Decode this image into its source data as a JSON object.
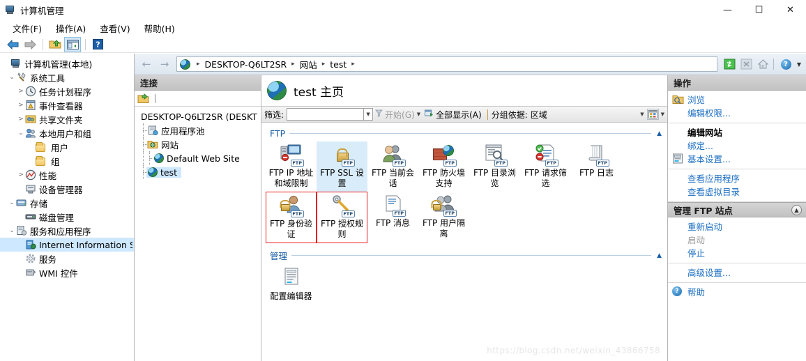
{
  "window": {
    "title": "计算机管理",
    "icon": "computer-management-icon",
    "minimize": "—",
    "maximize": "☐",
    "close": "✕"
  },
  "menubar": [
    {
      "label": "文件(F)",
      "name": "menu-file"
    },
    {
      "label": "操作(A)",
      "name": "menu-action"
    },
    {
      "label": "查看(V)",
      "name": "menu-view"
    },
    {
      "label": "帮助(H)",
      "name": "menu-help"
    }
  ],
  "toolbar": [
    {
      "name": "back-arrow-icon",
      "title": "后退"
    },
    {
      "name": "forward-arrow-icon",
      "title": "前进"
    },
    {
      "name": "up-folder-icon",
      "title": "向上"
    },
    {
      "name": "show-console-tree-icon",
      "title": "显示/隐藏控制台树"
    },
    {
      "name": "help-icon",
      "title": "帮助"
    }
  ],
  "tree": {
    "items": [
      {
        "label": "计算机管理(本地)",
        "indent": 0,
        "twisty": "",
        "icon": "computer-icon",
        "selected": false
      },
      {
        "label": "系统工具",
        "indent": 1,
        "twisty": "v",
        "icon": "tools-icon",
        "selected": false
      },
      {
        "label": "任务计划程序",
        "indent": 2,
        "twisty": ">",
        "icon": "clock-icon",
        "selected": false
      },
      {
        "label": "事件查看器",
        "indent": 2,
        "twisty": ">",
        "icon": "event-viewer-icon",
        "selected": false
      },
      {
        "label": "共享文件夹",
        "indent": 2,
        "twisty": ">",
        "icon": "shared-folder-icon",
        "selected": false
      },
      {
        "label": "本地用户和组",
        "indent": 2,
        "twisty": "v",
        "icon": "users-groups-icon",
        "selected": false
      },
      {
        "label": "用户",
        "indent": 3,
        "twisty": "",
        "icon": "folder-icon",
        "selected": false
      },
      {
        "label": "组",
        "indent": 3,
        "twisty": "",
        "icon": "folder-icon",
        "selected": false
      },
      {
        "label": "性能",
        "indent": 2,
        "twisty": ">",
        "icon": "performance-icon",
        "selected": false
      },
      {
        "label": "设备管理器",
        "indent": 2,
        "twisty": "",
        "icon": "device-manager-icon",
        "selected": false
      },
      {
        "label": "存储",
        "indent": 1,
        "twisty": "v",
        "icon": "storage-icon",
        "selected": false
      },
      {
        "label": "磁盘管理",
        "indent": 2,
        "twisty": "",
        "icon": "disk-icon",
        "selected": false
      },
      {
        "label": "服务和应用程序",
        "indent": 1,
        "twisty": "v",
        "icon": "services-apps-icon",
        "selected": false
      },
      {
        "label": "Internet Information S",
        "indent": 2,
        "twisty": "",
        "icon": "iis-icon",
        "selected": true
      },
      {
        "label": "服务",
        "indent": 2,
        "twisty": "",
        "icon": "service-gear-icon",
        "selected": false
      },
      {
        "label": "WMI 控件",
        "indent": 2,
        "twisty": "",
        "icon": "wmi-icon",
        "selected": false
      }
    ]
  },
  "address": {
    "back": "←",
    "forward": "→",
    "site_icon": "globe-icon",
    "crumbs": [
      "DESKTOP-Q6LT2SR",
      "网站",
      "test"
    ],
    "separator": "▸",
    "buttons": [
      {
        "name": "refresh-icon",
        "glyph": "refresh"
      },
      {
        "name": "stop-icon",
        "glyph": "stop"
      },
      {
        "name": "home-icon",
        "glyph": "home"
      },
      {
        "name": "help-icon",
        "glyph": "help"
      },
      {
        "name": "chevron-down-icon",
        "glyph": "caret"
      }
    ]
  },
  "connections": {
    "header": "连接",
    "toolbar_icon": "connect-folder-icon",
    "root": "DESKTOP-Q6LT2SR (DESKT",
    "items": [
      {
        "label": "应用程序池",
        "icon": "app-pools-icon",
        "indent": 0,
        "selected": false
      },
      {
        "label": "网站",
        "icon": "sites-folder-icon",
        "indent": 0,
        "selected": false
      },
      {
        "label": "Default Web Site",
        "icon": "globe-icon",
        "indent": 1,
        "selected": false
      },
      {
        "label": "test",
        "icon": "globe-icon",
        "indent": 1,
        "selected": true
      }
    ]
  },
  "content": {
    "page_title": "test 主页",
    "page_icon": "globe-icon",
    "filter": {
      "label": "筛选:",
      "value": "",
      "placeholder": "",
      "go_label": "开始(G)",
      "go_icon": "funnel-icon",
      "showall_label": "全部显示(A)",
      "showall_icon": "show-all-icon",
      "groupby_label": "分组依据:",
      "groupby_value": "区域",
      "view_icon": "view-mode-icon"
    },
    "groups": [
      {
        "name": "FTP",
        "chevron": "⌃",
        "items": [
          {
            "label": "FTP IP 地址和域限制",
            "icon": "ftp-ip-restrict-icon",
            "selected": false,
            "marked": false
          },
          {
            "label": "FTP SSL 设置",
            "icon": "ftp-ssl-icon",
            "selected": true,
            "marked": false
          },
          {
            "label": "FTP 当前会话",
            "icon": "ftp-sessions-icon",
            "selected": false,
            "marked": false
          },
          {
            "label": "FTP 防火墙支持",
            "icon": "ftp-firewall-icon",
            "selected": false,
            "marked": false
          },
          {
            "label": "FTP 目录浏览",
            "icon": "ftp-dir-browse-icon",
            "selected": false,
            "marked": false
          },
          {
            "label": "FTP 请求筛选",
            "icon": "ftp-request-filter-icon",
            "selected": false,
            "marked": false
          },
          {
            "label": "FTP 日志",
            "icon": "ftp-log-icon",
            "selected": false,
            "marked": false
          },
          {
            "label": "FTP 身份验证",
            "icon": "ftp-auth-icon",
            "selected": false,
            "marked": true
          },
          {
            "label": "FTP 授权规则",
            "icon": "ftp-authz-icon",
            "selected": false,
            "marked": true
          },
          {
            "label": "FTP 消息",
            "icon": "ftp-messages-icon",
            "selected": false,
            "marked": false
          },
          {
            "label": "FTP 用户隔离",
            "icon": "ftp-user-isolation-icon",
            "selected": false,
            "marked": false
          }
        ]
      },
      {
        "name": "管理",
        "chevron": "⌃",
        "items": [
          {
            "label": "配置编辑器",
            "icon": "config-editor-icon",
            "selected": false,
            "marked": false
          }
        ]
      }
    ]
  },
  "actions": {
    "header": "操作",
    "sections": [
      {
        "rows": [
          {
            "label": "浏览",
            "icon": "browse-icon",
            "style": "link",
            "name": "action-browse"
          },
          {
            "label": "编辑权限...",
            "icon": "",
            "style": "link",
            "name": "action-edit-permissions"
          }
        ]
      },
      {
        "rows": [
          {
            "label": "编辑网站",
            "icon": "",
            "style": "heading",
            "name": "action-group-edit-site"
          },
          {
            "label": "绑定...",
            "icon": "",
            "style": "link",
            "name": "action-bindings"
          },
          {
            "label": "基本设置...",
            "icon": "settings-icon",
            "style": "link",
            "name": "action-basic-settings"
          }
        ]
      },
      {
        "rows": [
          {
            "label": "查看应用程序",
            "icon": "",
            "style": "link",
            "name": "action-view-applications"
          },
          {
            "label": "查看虚拟目录",
            "icon": "",
            "style": "link",
            "name": "action-view-virtual-directories"
          }
        ]
      }
    ],
    "manage": {
      "header": "管理 FTP 站点",
      "collapse_icon": "chevron-up-icon",
      "rows": [
        {
          "label": "重新启动",
          "style": "link",
          "name": "action-restart"
        },
        {
          "label": "启动",
          "style": "disabled",
          "name": "action-start"
        },
        {
          "label": "停止",
          "style": "link",
          "name": "action-stop"
        }
      ],
      "advanced": {
        "label": "高级设置...",
        "name": "action-advanced-settings"
      },
      "help": {
        "label": "帮助",
        "icon": "help-icon",
        "name": "action-help"
      }
    }
  },
  "watermark": "https://blog.csdn.net/weixin_43866758"
}
